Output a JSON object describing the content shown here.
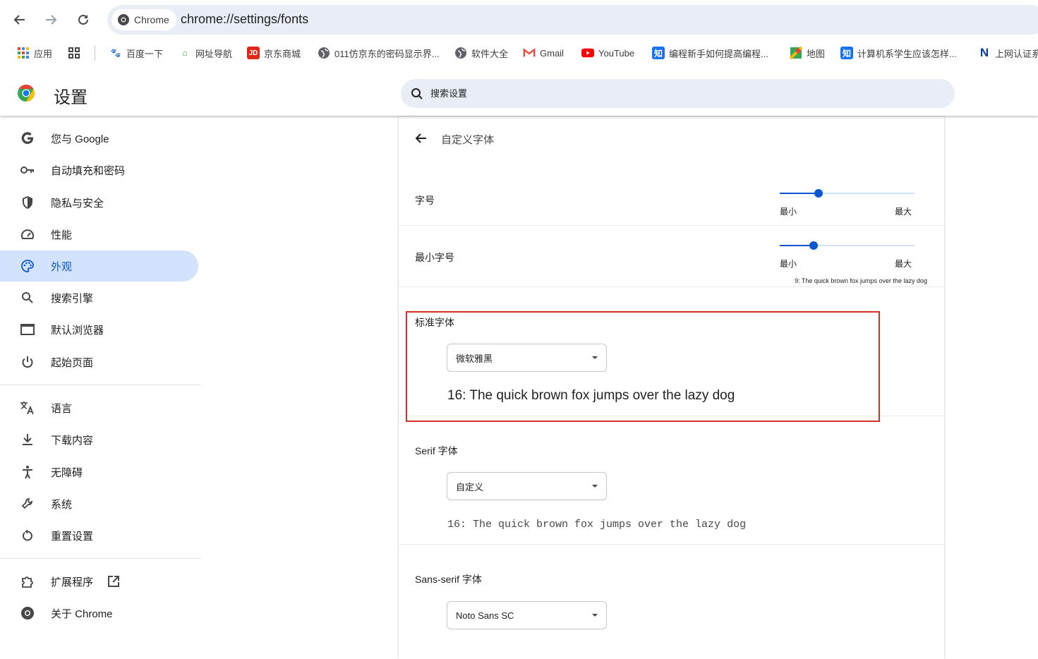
{
  "browser": {
    "chip_label": "Chrome",
    "url": "chrome://settings/fonts"
  },
  "bookmarks": [
    {
      "label": "应用",
      "icon": "apps-grid-icon"
    },
    {
      "label": "",
      "icon": "tab-groups-icon"
    },
    {
      "label": "百度一下",
      "icon": "baidu-icon"
    },
    {
      "label": "网址导航",
      "icon": "2345-icon"
    },
    {
      "label": "京东商城",
      "icon": "jd-icon"
    },
    {
      "label": "011仿京东的密码显示界...",
      "icon": "globe-icon"
    },
    {
      "label": "软件大全",
      "icon": "globe-icon"
    },
    {
      "label": "Gmail",
      "icon": "gmail-icon"
    },
    {
      "label": "YouTube",
      "icon": "youtube-icon"
    },
    {
      "label": "编程新手如何提高编程...",
      "icon": "zhihu-icon"
    },
    {
      "label": "地图",
      "icon": "maps-icon"
    },
    {
      "label": "计算机系学生应该怎样...",
      "icon": "zhihu-icon"
    },
    {
      "label": "上网认证系",
      "icon": "n-icon"
    }
  ],
  "settings": {
    "title": "设置",
    "search_placeholder": "搜索设置"
  },
  "sidebar": {
    "items": [
      {
        "label": "您与 Google",
        "icon": "google-icon"
      },
      {
        "label": "自动填充和密码",
        "icon": "key-icon"
      },
      {
        "label": "隐私与安全",
        "icon": "shield-icon"
      },
      {
        "label": "性能",
        "icon": "speedometer-icon"
      },
      {
        "label": "外观",
        "icon": "palette-icon",
        "active": true
      },
      {
        "label": "搜索引擎",
        "icon": "search-icon"
      },
      {
        "label": "默认浏览器",
        "icon": "browser-window-icon"
      },
      {
        "label": "起始页面",
        "icon": "power-icon"
      },
      {
        "label": "语言",
        "icon": "translate-icon"
      },
      {
        "label": "下载内容",
        "icon": "download-icon"
      },
      {
        "label": "无障碍",
        "icon": "accessibility-icon"
      },
      {
        "label": "系统",
        "icon": "wrench-icon"
      },
      {
        "label": "重置设置",
        "icon": "reset-icon"
      },
      {
        "label": "扩展程序",
        "icon": "extension-icon"
      },
      {
        "label": "关于 Chrome",
        "icon": "chrome-icon"
      }
    ]
  },
  "page": {
    "title": "自定义字体",
    "font_size": {
      "label": "字号",
      "min_label": "最小",
      "max_label": "最大",
      "value_fraction": 0.29
    },
    "min_font_size": {
      "label": "最小字号",
      "min_label": "最小",
      "max_label": "最大",
      "value_fraction": 0.25,
      "sample": "9: The quick brown fox jumps over the lazy dog"
    },
    "standard_font": {
      "label": "标准字体",
      "selected": "微软雅黑",
      "sample": "16: The quick brown fox jumps over the lazy dog"
    },
    "serif_font": {
      "label": "Serif 字体",
      "selected": "自定义",
      "sample": "16: The quick brown fox jumps over the lazy dog"
    },
    "sans_serif_font": {
      "label": "Sans-serif 字体",
      "selected": "Noto Sans SC"
    }
  },
  "colors": {
    "accent": "#0b57d0",
    "active_bg": "#d3e3fd",
    "highlight_border": "#d93025"
  }
}
